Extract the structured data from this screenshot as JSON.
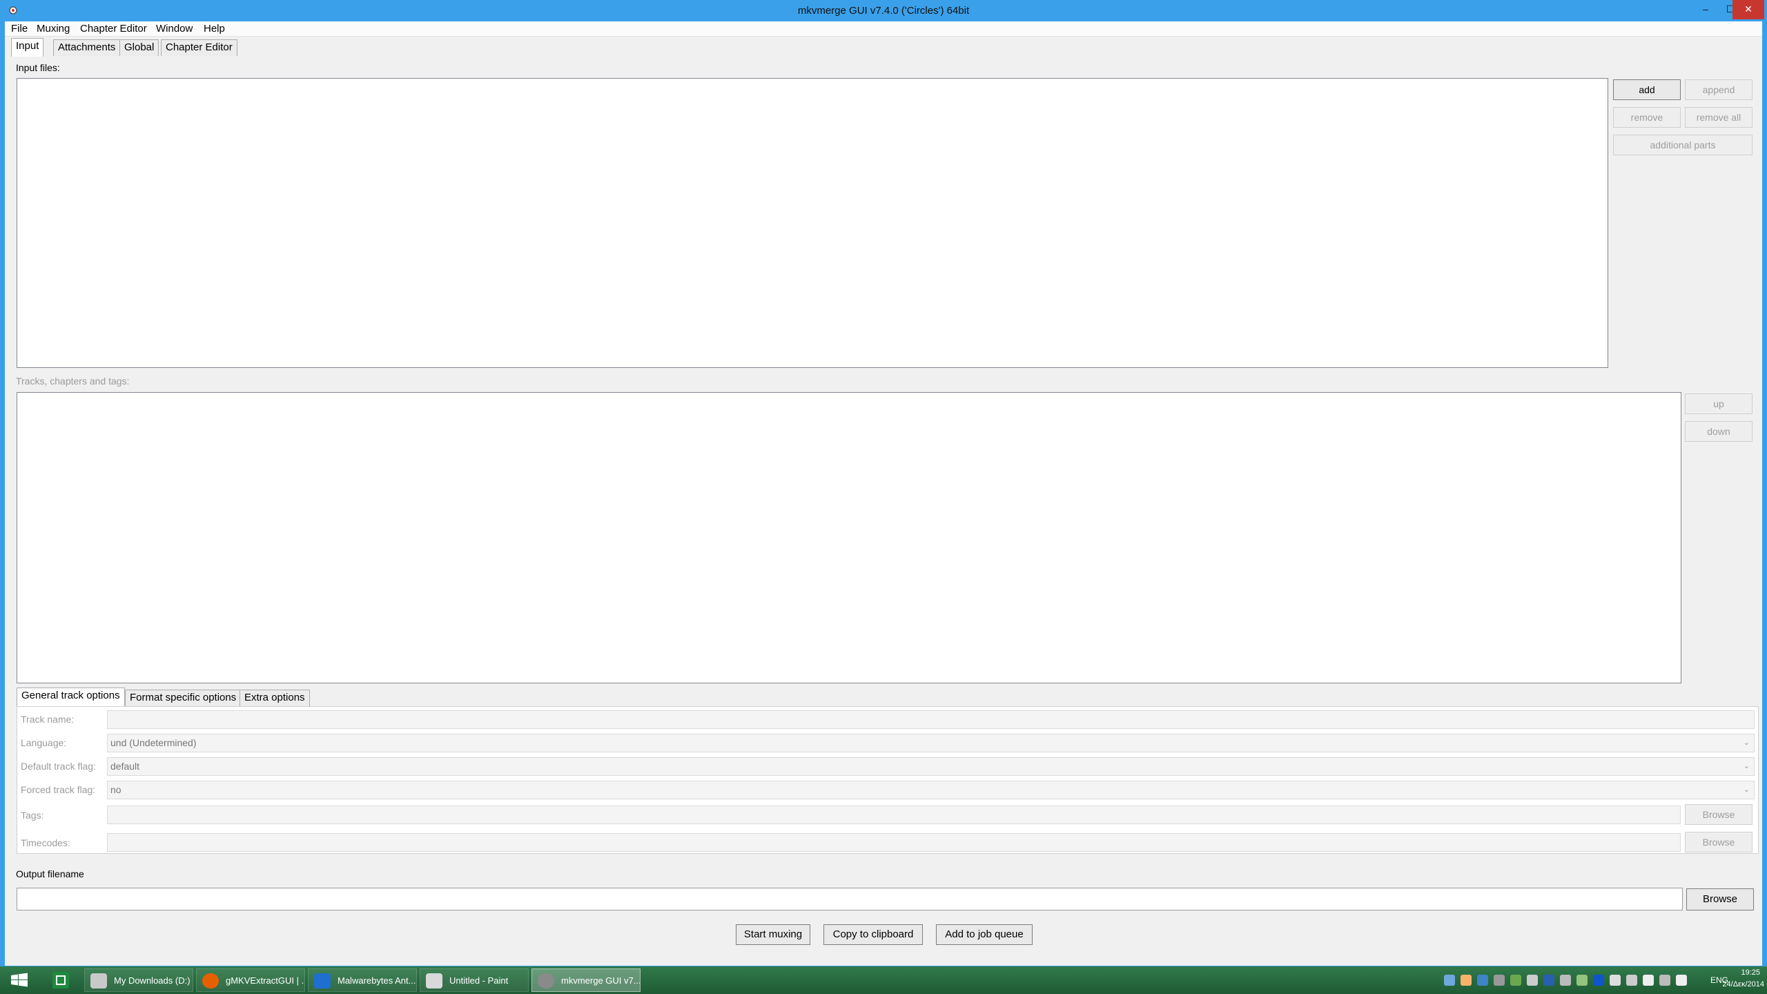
{
  "window": {
    "title": "mkvmerge GUI v7.4.0 ('Circles') 64bit",
    "controls": {
      "minimize": "–",
      "maximize": "☐",
      "close": "✕"
    }
  },
  "menu": [
    "File",
    "Muxing",
    "Chapter Editor",
    "Window",
    "Help"
  ],
  "main_tabs": [
    "Input",
    "Attachments",
    "Global",
    "Chapter Editor"
  ],
  "input": {
    "files_label": "Input files:",
    "buttons": {
      "add": "add",
      "append": "append",
      "remove": "remove",
      "remove_all": "remove all",
      "additional_parts": "additional parts"
    },
    "tracks_label": "Tracks, chapters and tags:",
    "tracks_buttons": {
      "up": "up",
      "down": "down"
    }
  },
  "track_tabs": [
    "General track options",
    "Format specific options",
    "Extra options"
  ],
  "track_options": {
    "track_name_label": "Track name:",
    "track_name_value": "",
    "language_label": "Language:",
    "language_value": "und (Undetermined)",
    "default_flag_label": "Default track flag:",
    "default_flag_value": "default",
    "forced_flag_label": "Forced track flag:",
    "forced_flag_value": "no",
    "tags_label": "Tags:",
    "tags_value": "",
    "timecodes_label": "Timecodes:",
    "timecodes_value": "",
    "browse": "Browse"
  },
  "output": {
    "label": "Output filename",
    "value": "",
    "browse": "Browse"
  },
  "actions": {
    "start": "Start muxing",
    "copy": "Copy to clipboard",
    "queue": "Add to job queue"
  },
  "taskbar": {
    "items": [
      {
        "label": "My Downloads (D:)",
        "icon": "folder-icon",
        "color": "#c9c9c9"
      },
      {
        "label": "gMKVExtractGUI | ...",
        "icon": "firefox-icon",
        "color": "#e66000"
      },
      {
        "label": "Malwarebytes Ant...",
        "icon": "malwarebytes-icon",
        "color": "#1f6fd1"
      },
      {
        "label": "Untitled - Paint",
        "icon": "paint-icon",
        "color": "#d9d9d9"
      },
      {
        "label": "mkvmerge GUI v7...",
        "icon": "mkvmerge-icon",
        "color": "#8a8a8a"
      }
    ],
    "language": "ENG",
    "time": "19:25",
    "date": "24/Δεκ/2014"
  },
  "colors": {
    "titlebar": "#3aa0ea",
    "client": "#f0f0f0",
    "taskbar": "#2b6e43"
  }
}
